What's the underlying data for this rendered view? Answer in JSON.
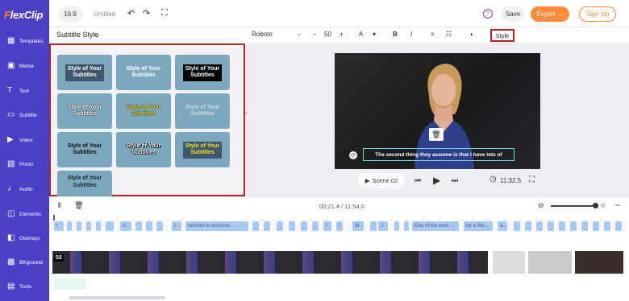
{
  "app": {
    "logo_initial": "F",
    "logo_rest": "lexClip"
  },
  "sidebar": {
    "items": [
      {
        "label": "Templates",
        "icon": "templates-icon"
      },
      {
        "label": "Media",
        "icon": "media-icon"
      },
      {
        "label": "Text",
        "icon": "text-icon"
      },
      {
        "label": "Subtitle",
        "icon": "subtitle-icon"
      },
      {
        "label": "Video",
        "icon": "video-icon"
      },
      {
        "label": "Photo",
        "icon": "photo-icon"
      },
      {
        "label": "Audio",
        "icon": "audio-icon"
      },
      {
        "label": "Elements",
        "icon": "elements-icon"
      },
      {
        "label": "Overlays",
        "icon": "overlays-icon"
      },
      {
        "label": "BKground",
        "icon": "background-icon"
      },
      {
        "label": "Tools",
        "icon": "tools-icon"
      }
    ]
  },
  "topbar": {
    "ratio": "16:9",
    "title": "Untitled",
    "save": "Save",
    "export": "Export →",
    "signup": "Sign Up",
    "help": "?"
  },
  "panel": {
    "title": "Subtitle Style",
    "tiles": [
      {
        "line1": "Style of Your",
        "line2": "Subtitles"
      },
      {
        "line1": "Style of Your",
        "line2": "Subtitles"
      },
      {
        "line1": "Style of Your",
        "line2": "Subtitles"
      },
      {
        "line1": "Style of Your",
        "line2": "Subtitles"
      },
      {
        "line1": "Style of Your",
        "line2": "Subtitles"
      },
      {
        "line1": "Style of Your",
        "line2": "Subtitles"
      },
      {
        "line1": "Style of Your",
        "line2": "Subtitles"
      },
      {
        "line1": "Style of Your",
        "line2": "Subtitles"
      },
      {
        "line1": "Style of Your",
        "line2": "Subtitles"
      },
      {
        "line1": "Style of Your",
        "line2": "Subtitles"
      }
    ]
  },
  "text_toolbar": {
    "font": "Roboto",
    "size": "50",
    "minus": "−",
    "plus": "+",
    "style_button": "Style"
  },
  "preview": {
    "subtitle": "The second thing they assume is that I have lots of",
    "scene": "Scene 02",
    "duration": "11:32.5"
  },
  "timeline": {
    "time": "00:21.4 / 11:54.0",
    "track_label": "02",
    "chips": [
      "I",
      "A",
      "I",
      "minutes to exercise.",
      "I",
      "I",
      "W",
      "J",
      "One of the wom...",
      "for a We...",
      "a..."
    ]
  },
  "colors": {
    "sidebar": "#4b3fc6",
    "accent": "#ff8a3c",
    "highlight": "#b52222",
    "subtitle_border": "#6fd3e0"
  }
}
